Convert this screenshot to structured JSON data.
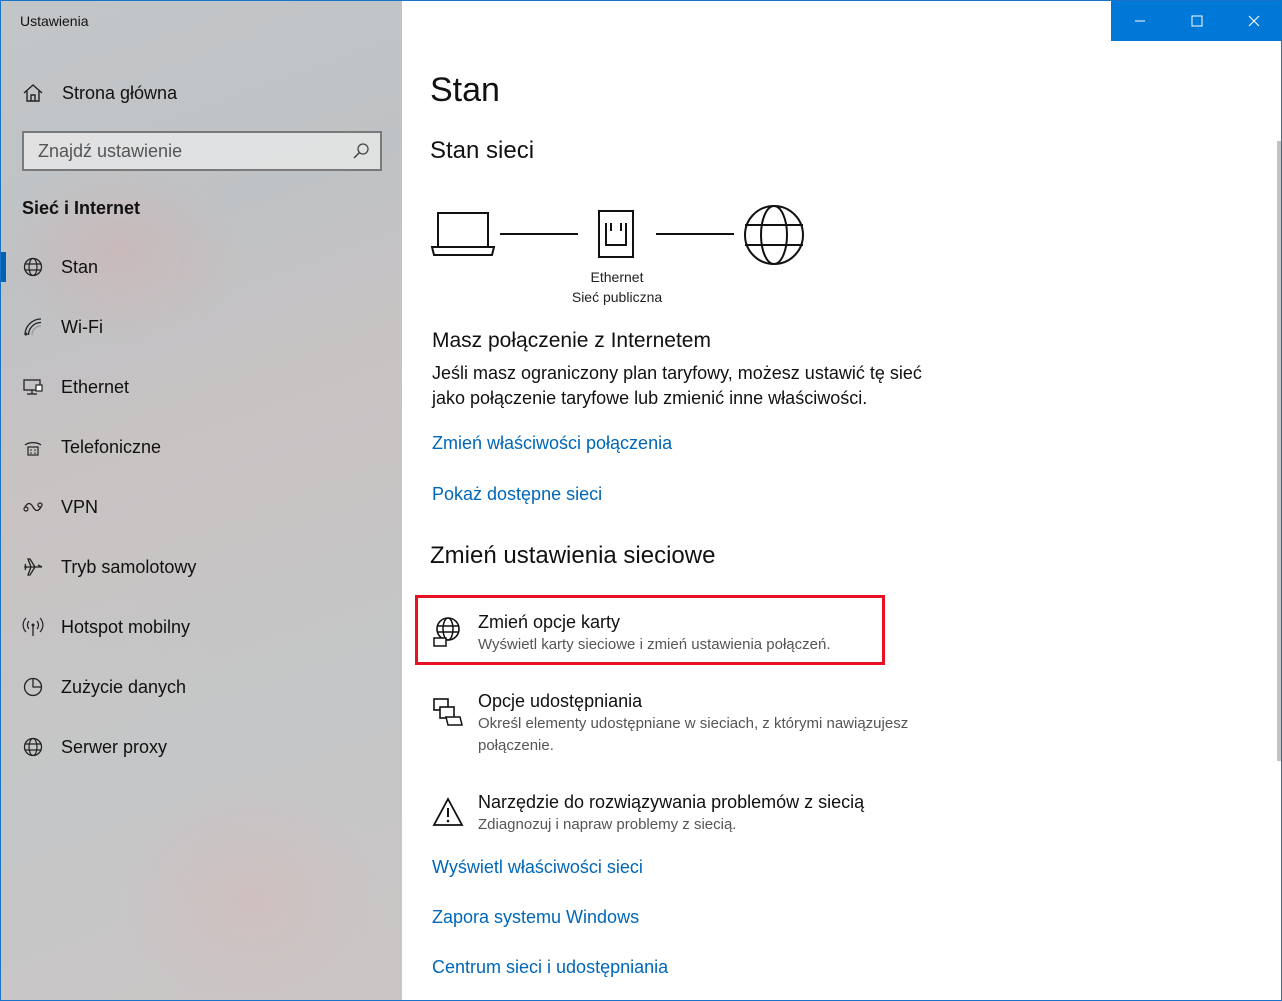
{
  "window": {
    "title": "Ustawienia",
    "accent": "#0078d7",
    "link_color": "#0067b8",
    "highlight_color": "#e81123"
  },
  "sidebar": {
    "home_label": "Strona główna",
    "search_placeholder": "Znajdź ustawienie",
    "section_title": "Sieć i Internet",
    "items": [
      {
        "label": "Stan",
        "icon": "globe-icon",
        "active": true
      },
      {
        "label": "Wi-Fi",
        "icon": "wifi-icon"
      },
      {
        "label": "Ethernet",
        "icon": "ethernet-icon"
      },
      {
        "label": "Telefoniczne",
        "icon": "dialup-icon"
      },
      {
        "label": "VPN",
        "icon": "vpn-icon"
      },
      {
        "label": "Tryb samolotowy",
        "icon": "airplane-icon"
      },
      {
        "label": "Hotspot mobilny",
        "icon": "hotspot-icon"
      },
      {
        "label": "Zużycie danych",
        "icon": "data-usage-icon"
      },
      {
        "label": "Serwer proxy",
        "icon": "globe-icon"
      }
    ]
  },
  "main": {
    "title": "Stan",
    "network_status_heading": "Stan sieci",
    "network_name": "Ethernet",
    "network_type": "Sieć publiczna",
    "connection_title": "Masz połączenie z Internetem",
    "connection_desc": "Jeśli masz ograniczony plan taryfowy, możesz ustawić tę sieć jako połączenie taryfowe lub zmienić inne właściwości.",
    "link_change_props": "Zmień właściwości połączenia",
    "link_show_networks": "Pokaż dostępne sieci",
    "change_settings_heading": "Zmień ustawienia sieciowe",
    "options": [
      {
        "title": "Zmień opcje karty",
        "desc": "Wyświetl karty sieciowe i zmień ustawienia połączeń.",
        "icon": "adapter-globe-icon"
      },
      {
        "title": "Opcje udostępniania",
        "desc": "Określ elementy udostępniane w sieciach, z którymi nawiązujesz połączenie.",
        "icon": "sharing-icon"
      },
      {
        "title": "Narzędzie do rozwiązywania problemów z siecią",
        "desc": "Zdiagnozuj i napraw problemy z siecią.",
        "icon": "warning-icon"
      }
    ],
    "links_bottom": [
      "Wyświetl właściwości sieci",
      "Zapora systemu Windows",
      "Centrum sieci i udostępniania"
    ]
  }
}
